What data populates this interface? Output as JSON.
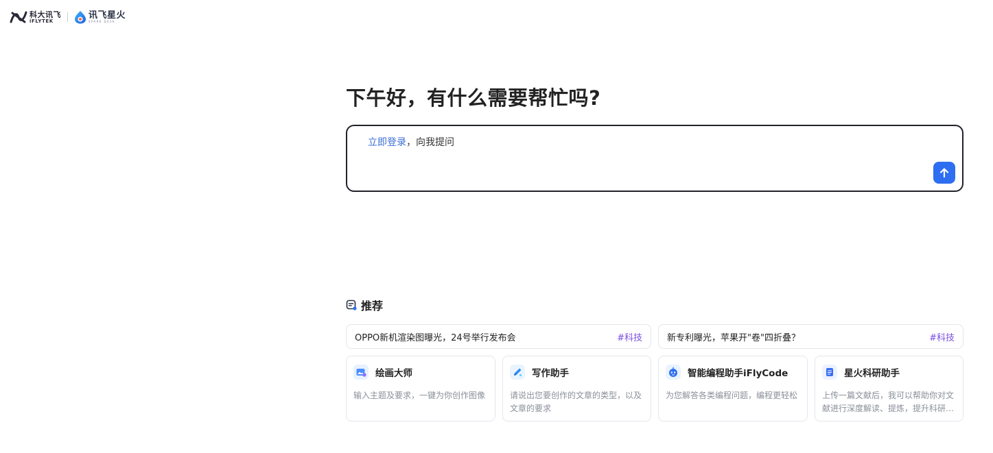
{
  "header": {
    "iflytek_logo": {
      "cn": "科大讯飞",
      "en": "iFLYTEK"
    },
    "spark_logo": {
      "cn": "讯飞星火",
      "en": "SPARK DESK"
    }
  },
  "greeting": "下午好，有什么需要帮忙吗?",
  "input": {
    "login_link": "立即登录",
    "prompt_suffix": "，向我提问",
    "send_icon": "arrow-up-icon"
  },
  "recommend": {
    "title": "推荐",
    "icon": "recommend-icon",
    "news": [
      {
        "text": "OPPO新机渲染图曝光，24号举行发布会",
        "tag": "#科技"
      },
      {
        "text": "新专利曝光，苹果开\"卷\"四折叠？",
        "tag": "#科技"
      }
    ],
    "tools": [
      {
        "name": "绘画大师",
        "desc": "输入主题及要求，一键为你创作图像",
        "icon": "paint-icon"
      },
      {
        "name": "写作助手",
        "desc": "请说出您要创作的文章的类型，以及文章的要求",
        "icon": "pen-icon"
      },
      {
        "name": "智能编程助手iFlyCode",
        "desc": "为您解答各类编程问题，编程更轻松",
        "icon": "robot-icon"
      },
      {
        "name": "星火科研助手",
        "desc": "上传一篇文献后，我可以帮助你对文献进行深度解读、提炼，提升科研效率",
        "icon": "document-icon"
      }
    ]
  },
  "colors": {
    "accent": "#2d6ff0",
    "tag": "#7a4fe0",
    "link": "#3b6fd4"
  }
}
